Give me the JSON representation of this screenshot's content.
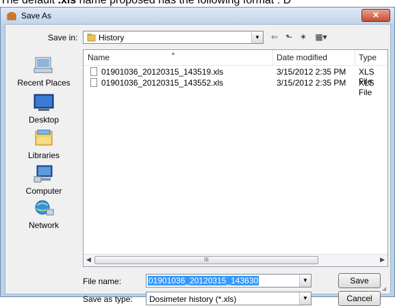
{
  "document": {
    "text_prefix": "The default ",
    "text_bold": ".xls",
    "text_suffix": " name proposed has the following format : D"
  },
  "window": {
    "title": "Save As",
    "close_label": "✕"
  },
  "save_in": {
    "label": "Save in:",
    "value": "History"
  },
  "toolbar": {
    "back": "⇐",
    "up": "⬑",
    "new_folder": "✶",
    "views": "▦▾"
  },
  "places": [
    {
      "label": "Recent Places",
      "icon": "recent-places-icon"
    },
    {
      "label": "Desktop",
      "icon": "desktop-icon"
    },
    {
      "label": "Libraries",
      "icon": "libraries-icon"
    },
    {
      "label": "Computer",
      "icon": "computer-icon"
    },
    {
      "label": "Network",
      "icon": "network-icon"
    }
  ],
  "file_list": {
    "columns": [
      "Name",
      "Date modified",
      "Type"
    ],
    "rows": [
      {
        "name": "01901036_20120315_143519.xls",
        "date": "3/15/2012 2:35 PM",
        "type": "XLS File"
      },
      {
        "name": "01901036_20120315_143552.xls",
        "date": "3/15/2012 2:35 PM",
        "type": "XLS File"
      }
    ],
    "scroll_thumb_label": "III"
  },
  "file_name": {
    "label": "File name:",
    "value": "01901036_20120315_143630"
  },
  "save_as_type": {
    "label": "Save as type:",
    "value": "Dosimeter history (*.xls)"
  },
  "buttons": {
    "save": "Save",
    "cancel": "Cancel"
  },
  "colors": {
    "selection": "#3399ff",
    "frame": "#bcd0e8"
  }
}
